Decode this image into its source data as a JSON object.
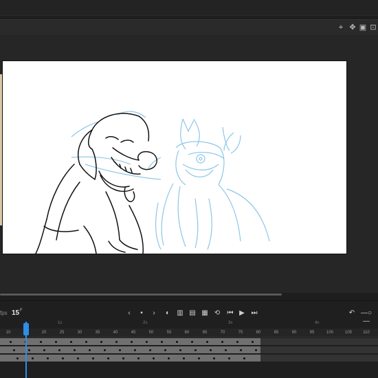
{
  "toolbar": {
    "icons": [
      "center-stage-icon",
      "clip-icon",
      "crop-icon",
      "fit-icon"
    ]
  },
  "timeline": {
    "frame_label": "fps",
    "current_frame": "15",
    "frame_unit": "F",
    "seconds": [
      "1s",
      "2s",
      "3s",
      "4s"
    ],
    "ruler_ticks": [
      "10",
      "15",
      "20",
      "25",
      "30",
      "35",
      "40",
      "45",
      "50",
      "55",
      "60",
      "65",
      "70",
      "75",
      "80",
      "85",
      "90",
      "95",
      "100",
      "105",
      "110"
    ],
    "controls": [
      "prev-icon",
      "stop-icon",
      "next-icon",
      "onion-icon",
      "onion-multi-icon",
      "edit-multi-icon",
      "loop-icon",
      "step-back-icon",
      "play-icon",
      "step-forward-icon"
    ],
    "layers": [
      {
        "name": "layer-1"
      },
      {
        "name": "layer-2"
      },
      {
        "name": "layer-3"
      }
    ]
  },
  "stage": {
    "background_color": "#ffffff",
    "ink_color": "#111111",
    "sketch_color": "#8cc6e6"
  }
}
